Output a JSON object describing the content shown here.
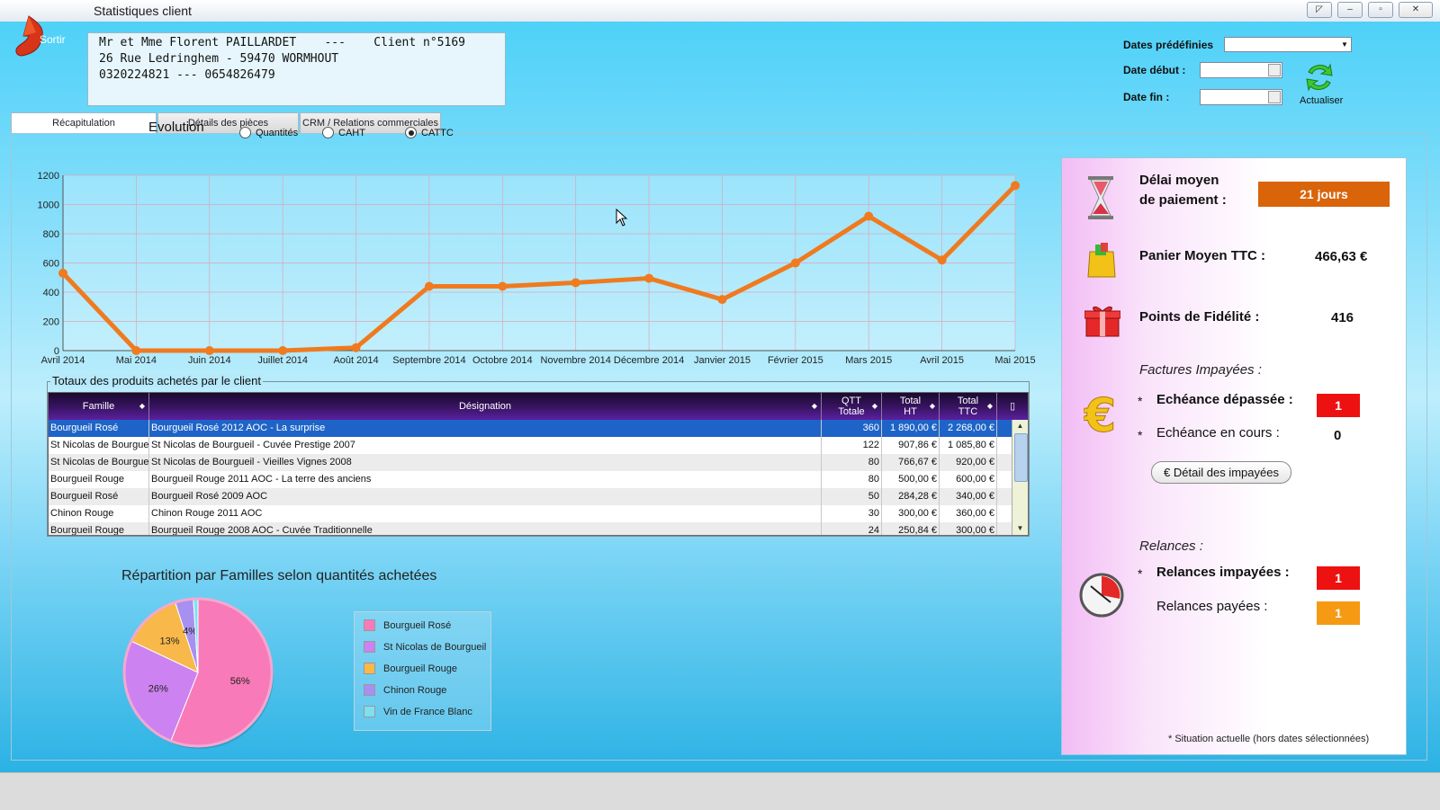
{
  "window": {
    "title": "Statistiques client"
  },
  "toolbar": {
    "sortir_label": "Sortir"
  },
  "client": {
    "line1": "Mr et Mme Florent PAILLARDET    ---    Client n°5169",
    "line2": "26 Rue Ledringhem - 59470 WORMHOUT",
    "line3": "0320224821 --- 0654826479"
  },
  "dates": {
    "predef_label": "Dates prédéfinies",
    "predef_value": "",
    "debut_label": "Date début :",
    "debut_value": "",
    "fin_label": "Date fin :",
    "fin_value": "",
    "refresh_label": "Actualiser"
  },
  "tabs": [
    {
      "label": "Récapitulation",
      "active": true
    },
    {
      "label": "Détails des pièces",
      "active": false
    },
    {
      "label": "CRM / Relations commerciales",
      "active": false
    }
  ],
  "evolution": {
    "title": "Evolution",
    "options": [
      {
        "label": "Quantités",
        "checked": false
      },
      {
        "label": "CAHT",
        "checked": false
      },
      {
        "label": "CATTC",
        "checked": true
      }
    ]
  },
  "chart_data": [
    {
      "type": "line",
      "x": [
        "Avril 2014",
        "Mai 2014",
        "Juin 2014",
        "Juillet 2014",
        "Août 2014",
        "Septembre 2014",
        "Octobre 2014",
        "Novembre 2014",
        "Décembre 2014",
        "Janvier 2015",
        "Février 2015",
        "Mars 2015",
        "Avril 2015",
        "Mai 2015"
      ],
      "values": [
        530,
        0,
        0,
        0,
        20,
        440,
        440,
        465,
        495,
        350,
        600,
        920,
        620,
        1130
      ],
      "yticks": [
        0,
        200,
        400,
        600,
        800,
        1000,
        1200
      ],
      "ylim": [
        0,
        1200
      ],
      "grid": true,
      "color": "#f07a1e"
    },
    {
      "type": "pie",
      "title": "Répartition par Familles selon quantités achetées",
      "categories": [
        "Bourgueil Rosé",
        "St Nicolas de Bourgueil",
        "Bourgueil Rouge",
        "Chinon Rouge",
        "Vin de France Blanc"
      ],
      "values": [
        56,
        26,
        13,
        4,
        1
      ],
      "labels": [
        "56%",
        "26%",
        "13%",
        "4%",
        ""
      ],
      "colors": [
        "#f87ab8",
        "#cc82f0",
        "#f8b84a",
        "#a890f0",
        "#7fe0f0"
      ],
      "legend": "right"
    }
  ],
  "table": {
    "legend": "Totaux des produits achetés par le client",
    "columns": [
      "Famille",
      "Désignation",
      "QTT\nTotale",
      "Total\nHT",
      "Total\nTTC"
    ],
    "rows": [
      [
        "Bourgueil Rosé",
        "Bourgueil Rosé 2012 AOC - La surprise",
        "360",
        "1 890,00 €",
        "2 268,00 €"
      ],
      [
        "St Nicolas de Bourgueil",
        "St Nicolas de Bourgueil - Cuvée Prestige 2007",
        "122",
        "907,86 €",
        "1 085,80 €"
      ],
      [
        "St Nicolas de Bourgueil",
        "St Nicolas de Bourgueil - Vieilles Vignes 2008",
        "80",
        "766,67 €",
        "920,00 €"
      ],
      [
        "Bourgueil Rouge",
        "Bourgueil Rouge 2011 AOC - La terre des anciens",
        "80",
        "500,00 €",
        "600,00 €"
      ],
      [
        "Bourgueil Rosé",
        "Bourgueil Rosé 2009 AOC",
        "50",
        "284,28 €",
        "340,00 €"
      ],
      [
        "Chinon Rouge",
        "Chinon Rouge 2011 AOC",
        "30",
        "300,00 €",
        "360,00 €"
      ],
      [
        "Bourgueil Rouge",
        "Bourgueil Rouge 2008 AOC - Cuvée Traditionnelle",
        "24",
        "250,84 €",
        "300,00 €"
      ]
    ]
  },
  "stats": {
    "delai_label_1": "Délai moyen",
    "delai_label_2": "de paiement :",
    "delai_value": "21 jours",
    "panier_label": "Panier Moyen TTC :",
    "panier_value": "466,63 €",
    "points_label": "Points de Fidélité :",
    "points_value": "416",
    "factures_title": "Factures Impayées :",
    "echeance_depassee_label": "Echéance dépassée :",
    "echeance_depassee_value": "1",
    "echeance_cours_label": "Echéance en cours :",
    "echeance_cours_value": "0",
    "detail_button": "€ Détail des impayées",
    "relances_title": "Relances :",
    "relances_impayees_label": "Relances impayées :",
    "relances_impayees_value": "1",
    "relances_payees_label": "Relances payées :",
    "relances_payees_value": "1",
    "star": "*",
    "footnote": "* Situation actuelle (hors dates sélectionnées)",
    "colors": {
      "orange": "#d9640a",
      "red": "#ee1111",
      "amber": "#f69a14"
    }
  }
}
